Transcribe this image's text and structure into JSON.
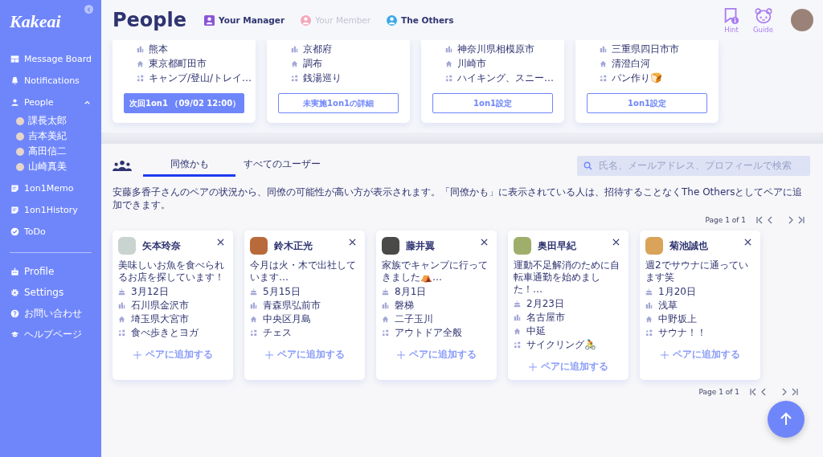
{
  "sidebar": {
    "logo": "Kakeai",
    "items": [
      {
        "label": "Message Board"
      },
      {
        "label": "Notifications"
      },
      {
        "label": "People",
        "expanded": true,
        "children": [
          {
            "label": "課長太郎"
          },
          {
            "label": "吉本美紀"
          },
          {
            "label": "高田信二"
          },
          {
            "label": "山崎真美"
          }
        ]
      },
      {
        "label": "1on1Memo"
      },
      {
        "label": "1on1History"
      },
      {
        "label": "ToDo"
      }
    ],
    "bottom_items": [
      {
        "label": "Profile"
      },
      {
        "label": "Settings"
      },
      {
        "label": "お問い合わせ"
      },
      {
        "label": "ヘルプページ"
      }
    ]
  },
  "header": {
    "title": "People",
    "filters": [
      {
        "label": "Your Manager",
        "color": "#8b55d6",
        "active": true
      },
      {
        "label": "Your Member",
        "color": "#f4a7b9",
        "active": false
      },
      {
        "label": "The Others",
        "color": "#3da9e6",
        "active": true
      }
    ],
    "tools": [
      {
        "label": "Hint"
      },
      {
        "label": "Guide"
      }
    ]
  },
  "pair_cards": [
    {
      "rows": [
        "熊本",
        "東京都町田市",
        "キャンプ/登山/トレイ…"
      ],
      "button": {
        "label": "次回1on1 （09/02 12:00）",
        "kind": "filled"
      }
    },
    {
      "rows": [
        "京都府",
        "調布",
        "銭湯巡り"
      ],
      "button": {
        "label": "未実施1on1の詳細",
        "kind": "outline"
      }
    },
    {
      "rows": [
        "神奈川県相模原市",
        "川崎市",
        "ハイキング、スニー…"
      ],
      "button": {
        "label": "1on1設定",
        "kind": "outline"
      }
    },
    {
      "rows": [
        "三重県四日市市",
        "清澄白河",
        "パン作り🍞"
      ],
      "button": {
        "label": "1on1設定",
        "kind": "outline"
      }
    }
  ],
  "suggestions": {
    "tabs": [
      {
        "label": "同僚かも",
        "selected": true
      },
      {
        "label": "すべてのユーザー",
        "selected": false
      }
    ],
    "search": {
      "placeholder": "氏名、メールアドレス、プロフィールで検索"
    },
    "description": "安藤多香子さんのペアの状況から、同僚の可能性が高い方が表示されます。「同僚かも」に表示されている人は、招待することなくThe Othersとしてペアに追加できます。",
    "pagination_top": "Page 1 of 1",
    "people": [
      {
        "name": "矢本玲奈",
        "message": "美味しいお魚を食べられるお店を探しています！",
        "rows": [
          "3月12日",
          "石川県金沢市",
          "埼玉県大宮市",
          "食べ歩きとヨガ"
        ],
        "action": "ペアに追加する"
      },
      {
        "name": "鈴木正光",
        "message": "今月は火・木で出社しています…",
        "rows": [
          "5月15日",
          "青森県弘前市",
          "中央区月島",
          "チェス"
        ],
        "action": "ペアに追加する"
      },
      {
        "name": "藤井翼",
        "message": "家族でキャンプに行ってきました⛺…",
        "rows": [
          "8月1日",
          "磐梯",
          "二子玉川",
          "アウトドア全般"
        ],
        "action": "ペアに追加する"
      },
      {
        "name": "奥田早紀",
        "message": "運動不足解消のために自転車通勤を始めました！…",
        "rows": [
          "2月23日",
          "名古屋市",
          "中延",
          "サイクリング🚴"
        ],
        "action": "ペアに追加する"
      },
      {
        "name": "菊池誠也",
        "message": "週2でサウナに通っています笑",
        "rows": [
          "1月20日",
          "浅草",
          "中野坂上",
          "サウナ！！"
        ],
        "action": "ペアに追加する"
      }
    ],
    "pagination_bottom": "Page 1 of 1"
  }
}
